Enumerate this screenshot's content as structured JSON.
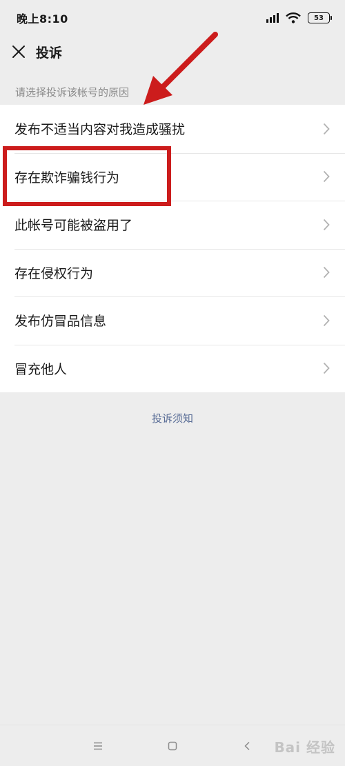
{
  "status_bar": {
    "time": "晚上8:10",
    "battery": "53"
  },
  "header": {
    "title": "投诉",
    "close_icon": "close-icon"
  },
  "section_label": "请选择投诉该帐号的原因",
  "reasons": [
    {
      "label": "发布不适当内容对我造成骚扰"
    },
    {
      "label": "存在欺诈骗钱行为"
    },
    {
      "label": "此帐号可能被盗用了"
    },
    {
      "label": "存在侵权行为"
    },
    {
      "label": "发布仿冒品信息"
    },
    {
      "label": "冒充他人"
    }
  ],
  "notice_link": "投诉须知",
  "colors": {
    "background": "#ededed",
    "list_background": "#ffffff",
    "link": "#576b95",
    "annotation_red": "#cc1c1c",
    "muted_text": "#8a8a8a"
  },
  "nav_bar": {
    "icons": [
      "menu-icon",
      "home-square-icon",
      "back-chevron-icon"
    ]
  },
  "watermark": "Bai 经验"
}
